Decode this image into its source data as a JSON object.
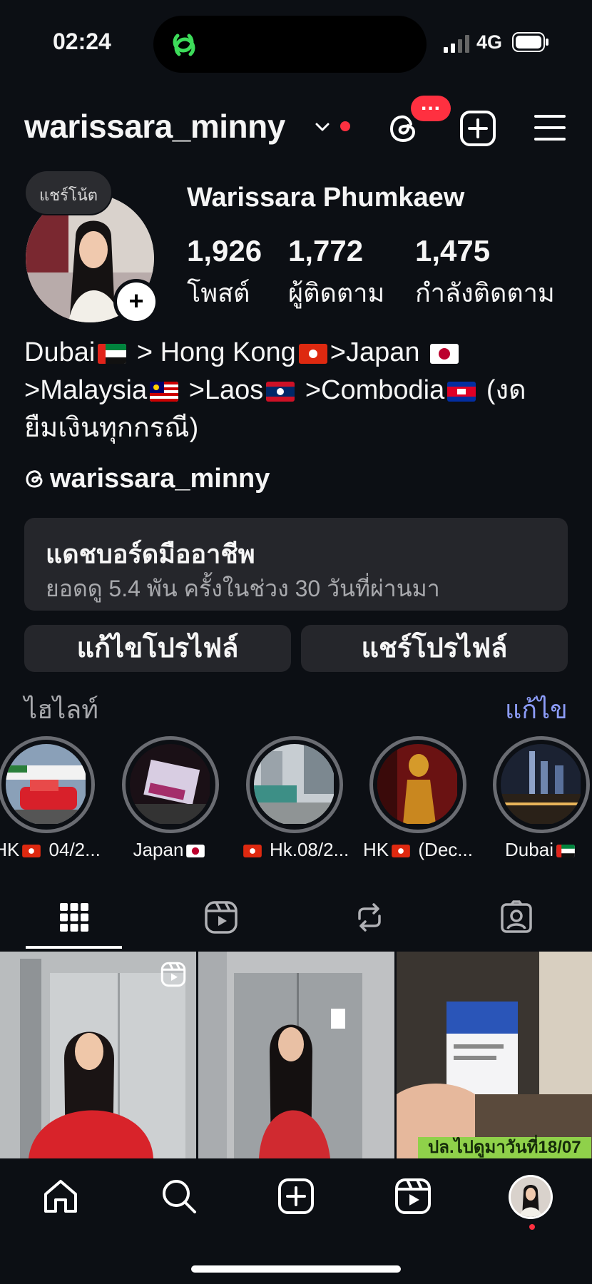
{
  "status_bar": {
    "time": "02:24",
    "network": "4G"
  },
  "header": {
    "username": "warissara_minny"
  },
  "profile": {
    "note": "แชร์โน้ต",
    "full_name": "Warissara Phumkaew",
    "stats": [
      {
        "value": "1,926",
        "label": "โพสต์"
      },
      {
        "value": "1,772",
        "label": "ผู้ติดตาม"
      },
      {
        "value": "1,475",
        "label": "กำลังติดตาม"
      }
    ],
    "bio": {
      "line1_a": "Dubai",
      "line1_b": " > Hong Kong",
      "line1_c": ">Japan ",
      "line2_a": ">Malaysia",
      "line2_b": " >Laos",
      "line2_c": " >Combodia",
      "line2_d": " (งด",
      "line3": "ยืมเงินทุกกรณี)"
    },
    "threads_handle": "warissara_minny"
  },
  "dashboard": {
    "title": "แดชบอร์ดมืออาชีพ",
    "subtitle": "ยอดดู 5.4 พัน ครั้งในช่วง 30 วันที่ผ่านมา"
  },
  "buttons": {
    "edit_profile": "แก้ไขโปรไฟล์",
    "share_profile": "แชร์โปรไฟล์"
  },
  "highlights": {
    "label": "ไฮไลท์",
    "edit": "แก้ไข",
    "items": [
      {
        "before": "HK",
        "after": " 04/2..."
      },
      {
        "before": "Japan",
        "after": ""
      },
      {
        "before": "",
        "after": " Hk.08/2..."
      },
      {
        "before": "HK",
        "after": " (Dec..."
      },
      {
        "before": "Dubai",
        "after": ""
      }
    ]
  },
  "posts": {
    "caption_3": "ปล.ไปดูมาวันที่18/07"
  },
  "icons": {
    "header": [
      "chevron-down-icon",
      "threads-icon",
      "add-post-icon",
      "menu-icon"
    ],
    "tabs": [
      "grid-icon",
      "reels-icon",
      "reposts-icon",
      "tagged-icon"
    ],
    "nav": [
      "home-icon",
      "search-icon",
      "create-icon",
      "reels-icon",
      "profile-avatar"
    ]
  },
  "colors": {
    "background": "#0c0f14",
    "card": "#25262b",
    "accent_link": "#8c9cf8",
    "notification": "#ff3040"
  }
}
